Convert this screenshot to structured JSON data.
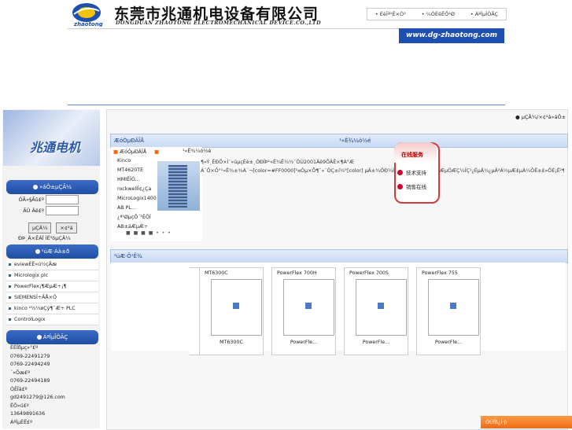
{
  "header": {
    "company_cn": "东莞市兆通机电设备有限公司",
    "company_en": "DONGDUAN ZHAOTONG ELECTROMECHANICAL DEVICE.CO.,LTD",
    "logo_text": "zhaotong",
    "url": "www.dg-zhaotong.com",
    "top_links": [
      "• ÉèÎª¹Ê×Ò³",
      "• ¼ÓÈëÊÕ²Ø",
      "• ÁªÏµÎÒÃÇ"
    ],
    "member_link": "µÇÂ¼/×¢²á»áÔ±"
  },
  "sidebar": {
    "banner_text": "兆通电机",
    "login_head": "»áÔ±µÇÂ¼",
    "username_label": "ÓÃ»§Ãû£º",
    "password_label": "ÃÜ  Âë£º",
    "login_btn": "µÇÂ¼",
    "register_btn": "×¢²á",
    "links": "ÐÞ¸Ä×ÊÁÏ  ÍË³öµÇÂ¼",
    "categories_head": "²úÆ·Àà±ð",
    "categories": [
      "eviewÈË»ú½çÃæ",
      "Micrologix plc",
      "PowerFlex¡¶ÆµÆ÷¡¶",
      "SIEMENSÎ÷ÃÅ×Ó",
      "kinco ²½½øÇý¶¯Æ÷ PLC",
      "ControlLogix"
    ],
    "contact_head": "ÁªÏµÎÒÃÇ",
    "contact": [
      "ÈÈÏßµç»°£º",
      "0769-22491279",
      "0769-22494249",
      "´«Õæ£º",
      "0769-22494189",
      "ÓÊÏä£º",
      "gd2491279@126.com",
      "ÊÖ»ú£º",
      "13649891636",
      "ÁªÏµÈË£º"
    ]
  },
  "main": {
    "news_head": "ÆóÒµÐÂÎÅ",
    "intro_head": "¹«Ë¾¼ò½é",
    "news_tag": "ÆóÒµÐÂÎÅ",
    "intro_tag": "¹«Ë¾¼ò½é",
    "news_items": [
      "Kinco",
      "MT4620TE",
      "HMIËÎÒ...",
      "rockwellÎ¢¿Ça",
      "MicroLogix1400",
      "AB PL...",
      "¿ª¹ØµçÔ´¹ÊÕÏ",
      "AB±äÆµÆ÷"
    ],
    "news_text": [
      "¶«Ý¸ÊÐÕ×Í¨»úµçÉè±¸ÓÐÏÞ¹«Ë¾Ê¼½¨ÓÚ2001Äê9ÔÂÊ×¶À°Æ",
      "À´Ô×Ó°¹«Ë¾±¾À´¬[color=#FF0000]¹¤Òµ×Ô¶¯»¯ÒÇ±í¼°[color] µÄ±¾ÖÐ¼ÌÖÎ¶ÎÃü¹ú¹¤ºÒÒµ·ÖÆµÖÆÇ¼ÏÇ¹¿ÉµÄ¼¿µÄ²Á½µÆ£µÀ¼ÒÊ±£»ÔÈ¡Ë²¶±â»ÒÚöµÒ¸¹Ï¿ÊÇÆÐÞ"
    ],
    "chat_title": "在线服务",
    "chat_support": "技术支持",
    "chat_sales": "销售在线",
    "products_head": "²úÆ·Õ¹Ê¾",
    "products": [
      {
        "title": "MT6300C",
        "caption": "MT6300C"
      },
      {
        "title": "PowerFlex 700H",
        "caption": "PowerFle..."
      },
      {
        "title": "PowerFlex 700S",
        "caption": "PowerFle..."
      },
      {
        "title": "PowerFlex 755",
        "caption": "PowerFle..."
      }
    ],
    "dots": "■ ■ ■ ■ • • •"
  },
  "float_bar": "ÔÚÏß¿Í·þ"
}
